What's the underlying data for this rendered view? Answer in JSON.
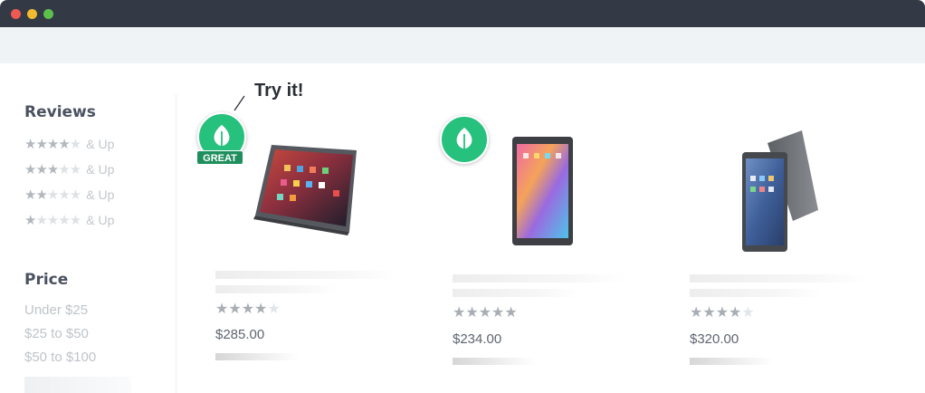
{
  "window": {
    "controls": {
      "close_color": "#ee5a52",
      "minimize_color": "#f0bb2f",
      "maximize_color": "#5cc14a"
    }
  },
  "sidebar": {
    "reviews_title": "Reviews",
    "review_filters": [
      {
        "stars": 4,
        "label": "& Up"
      },
      {
        "stars": 3,
        "label": "& Up"
      },
      {
        "stars": 2,
        "label": "& Up"
      },
      {
        "stars": 1,
        "label": "& Up"
      }
    ],
    "price_title": "Price",
    "price_options": [
      "Under $25",
      "$25 to $50",
      "$50 to $100"
    ]
  },
  "callout": {
    "text": "Try it!"
  },
  "badges": {
    "great_label": "GREAT",
    "icon": "leaf-icon",
    "color": "#27c17e"
  },
  "products": [
    {
      "image": "tablet-landscape-red-screen",
      "rating": 4,
      "price": "$285.00",
      "badge": "leaf-with-great"
    },
    {
      "image": "tablet-portrait-colorful-screen",
      "rating": 5,
      "price": "$234.00",
      "badge": "leaf"
    },
    {
      "image": "tablet-portrait-with-stand",
      "rating": 4,
      "price": "$320.00",
      "badge": null
    }
  ]
}
